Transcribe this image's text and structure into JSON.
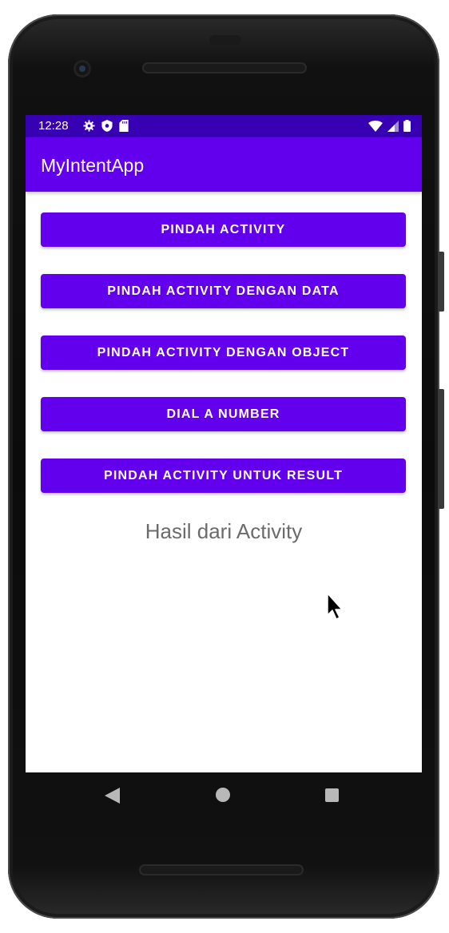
{
  "status_bar": {
    "time": "12:28",
    "icons_left": [
      "gear-icon",
      "shield-icon",
      "sd-card-icon"
    ],
    "icons_right": [
      "wifi-icon",
      "signal-icon",
      "battery-icon"
    ]
  },
  "app_bar": {
    "title": "MyIntentApp"
  },
  "buttons": [
    {
      "label": "PINDAH ACTIVITY"
    },
    {
      "label": "PINDAH ACTIVITY DENGAN DATA"
    },
    {
      "label": "PINDAH ACTIVITY DENGAN OBJECT"
    },
    {
      "label": "DIAL A NUMBER"
    },
    {
      "label": "PINDAH ACTIVITY UNTUK RESULT"
    }
  ],
  "result": {
    "text": "Hasil dari Activity"
  },
  "navigation": {
    "items": [
      "back-icon",
      "home-icon",
      "recents-icon"
    ]
  },
  "colors": {
    "primary": "#6200EE",
    "primary_dark": "#3700B3",
    "result_text": "#6b6b6b"
  }
}
